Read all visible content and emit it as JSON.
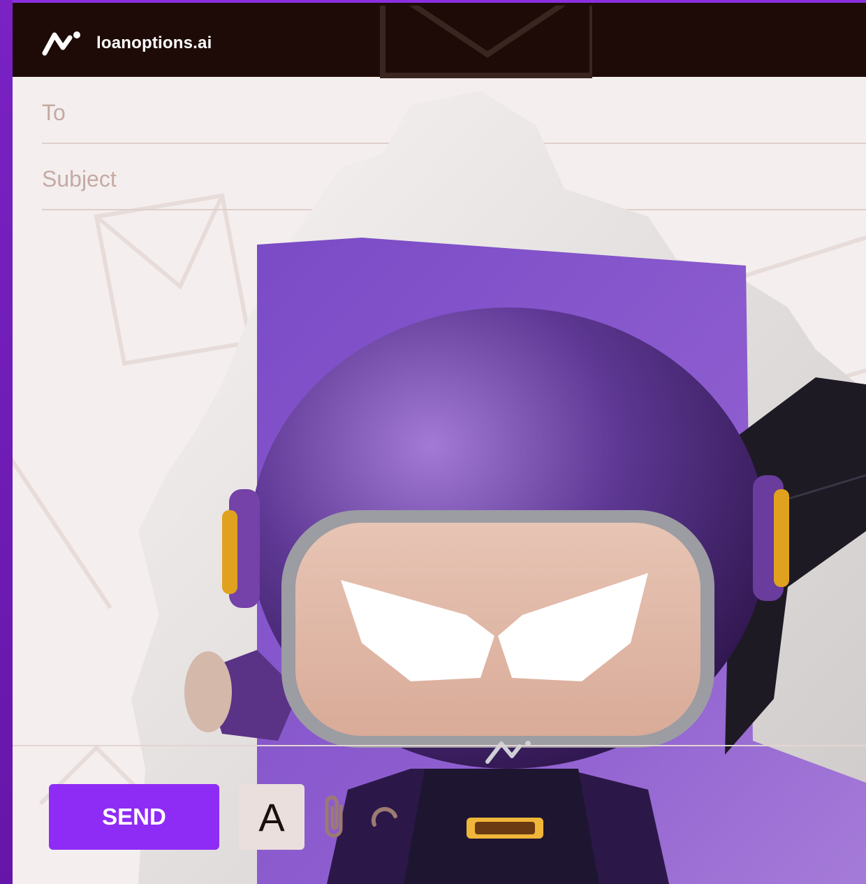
{
  "app": {
    "brand": "loanoptions.ai",
    "accent_color": "#8e2cf5",
    "topbar_color": "#1e0b07"
  },
  "compose": {
    "to_label": "To",
    "subject_label": "Subject",
    "send_label": "SEND",
    "format_label": "A",
    "attach_icon": "paperclip-icon",
    "link_icon": "link-icon"
  }
}
